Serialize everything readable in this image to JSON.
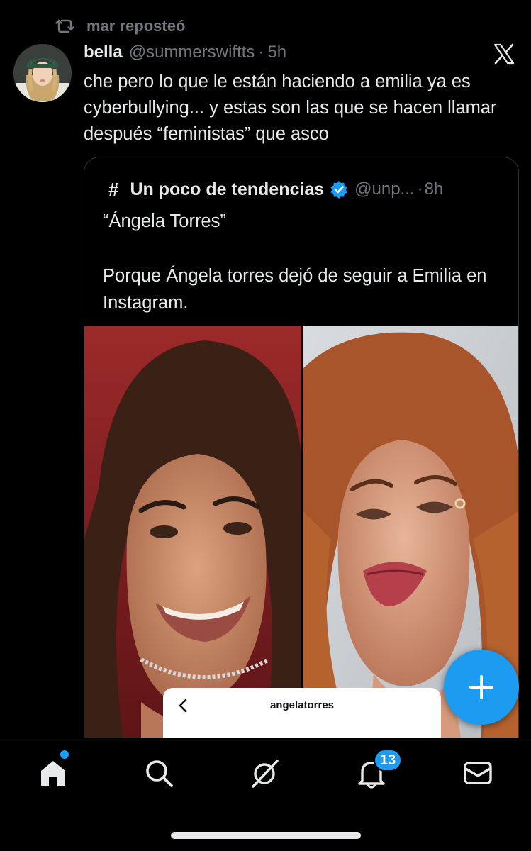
{
  "repost": {
    "text": "mar reposteó",
    "icon": "repost-icon"
  },
  "post": {
    "display_name": "bella",
    "handle": "@summerswiftts",
    "separator": "·",
    "time": "5h",
    "text": "che pero lo que le están haciendo a emilia ya es cyberbullying... y estas son las que se hacen llamar después “feministas” que asco",
    "avatar_icon": "avatar-image",
    "platform_icon": "x-logo-icon"
  },
  "quote": {
    "hash_symbol": "#",
    "display_name": "Un poco de tendencias",
    "verified_icon": "verified-badge-icon",
    "handle": "@unp...",
    "separator": "·",
    "time": "8h",
    "title": "“Ángela Torres”",
    "body": "Porque Ángela torres dejó de seguir a Emilia en Instagram.",
    "image_left": "photo-smiling-woman-dark-hair",
    "image_right": "photo-woman-auburn-hair",
    "overlay": {
      "username": "angelatorres",
      "back_icon": "chevron-left-icon"
    }
  },
  "fab": {
    "icon": "plus-icon",
    "color": "#1d9bf0"
  },
  "nav": {
    "items": [
      {
        "name": "home",
        "icon": "home-icon",
        "active": true,
        "has_dot": true
      },
      {
        "name": "search",
        "icon": "search-icon"
      },
      {
        "name": "grok",
        "icon": "grok-icon"
      },
      {
        "name": "notifications",
        "icon": "bell-icon",
        "badge": "13"
      },
      {
        "name": "messages",
        "icon": "mail-icon"
      }
    ],
    "notifications_badge": "13"
  },
  "colors": {
    "background": "#000000",
    "text_primary": "#e7e9ea",
    "text_secondary": "#71767b",
    "accent": "#1d9bf0",
    "border": "#2f3336"
  }
}
